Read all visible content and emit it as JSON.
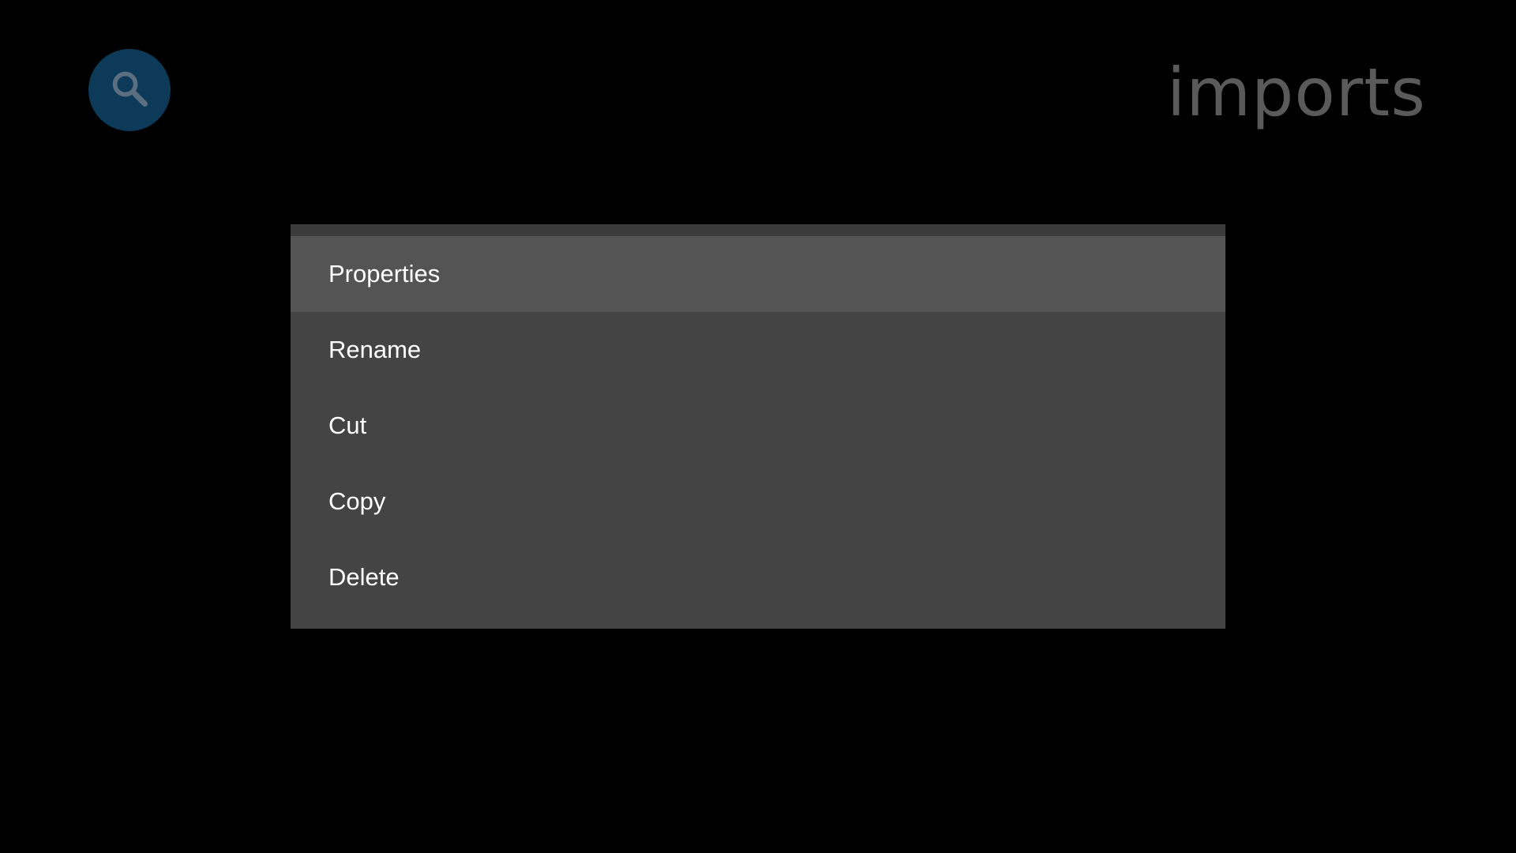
{
  "header": {
    "search_icon": "search-icon",
    "title": "imports"
  },
  "colors": {
    "background": "#000000",
    "search_button_bg": "#0e3a5a",
    "search_icon_color": "#5b6f80",
    "title_color": "#5a5a5a",
    "menu_bg": "#444444",
    "menu_focused_bg": "#545454",
    "menu_text": "#ffffff"
  },
  "context_menu": {
    "focused_index": 0,
    "items": [
      {
        "label": "Properties"
      },
      {
        "label": "Rename"
      },
      {
        "label": "Cut"
      },
      {
        "label": "Copy"
      },
      {
        "label": "Delete"
      }
    ]
  }
}
